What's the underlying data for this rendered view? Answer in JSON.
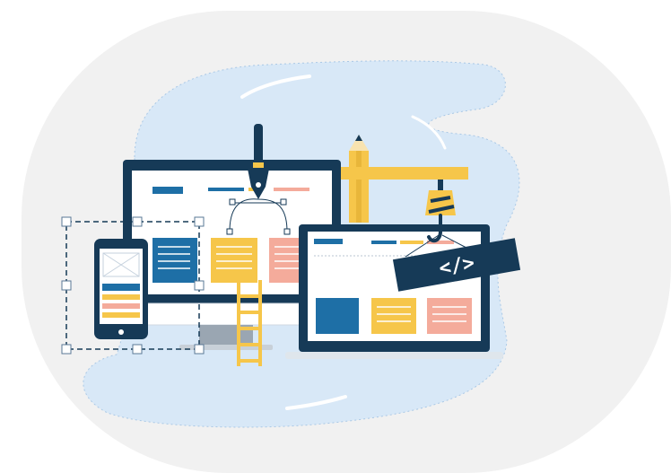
{
  "illustration": {
    "subject": "web-development-illustration",
    "code_tag_text": "</>",
    "icons": [
      "desktop-monitor-icon",
      "laptop-icon",
      "smartphone-icon",
      "pen-tool-icon",
      "pencil-icon",
      "crane-icon",
      "ladder-icon",
      "selection-box-icon"
    ]
  },
  "colors": {
    "background_panel": "#f1f1f1",
    "blob": "#d8e8f7",
    "navy": "#163a57",
    "yellow": "#f6c64a",
    "yellow_dark": "#e8b63a",
    "salmon": "#f4ab9b",
    "blue_card": "#1e6fa6",
    "white": "#ffffff",
    "grey_stand": "#c8d0d8"
  }
}
